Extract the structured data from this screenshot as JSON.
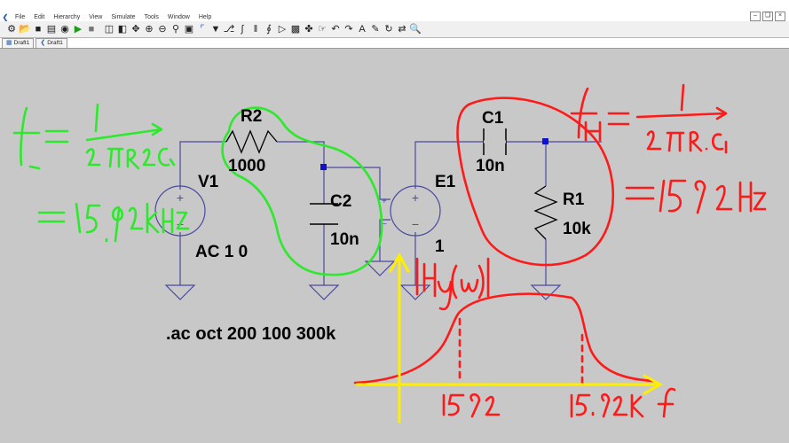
{
  "menu": [
    "File",
    "Edit",
    "Hierarchy",
    "View",
    "Simulate",
    "Tools",
    "Window",
    "Help"
  ],
  "toolbar_icons": [
    "hammer-icon",
    "open-icon",
    "save-icon",
    "print-icon",
    "cut-icon",
    "run-icon",
    "halt-icon",
    "tile-icon",
    "cascade-icon",
    "pan-icon",
    "zoom-in-icon",
    "zoom-out-icon",
    "zoom-fit-icon",
    "zoom-area-icon",
    "wire-icon",
    "ground-icon",
    "label-icon",
    "resistor-icon",
    "capacitor-icon",
    "inductor-icon",
    "diode-icon",
    "component-icon",
    "move-icon",
    "drag-icon",
    "undo-icon",
    "redo-icon",
    "text-icon",
    "spice-directive-icon",
    "rotate-icon",
    "mirror-icon",
    "find-icon"
  ],
  "tabs": [
    {
      "label": "Draft1"
    },
    {
      "label": "Draft1"
    }
  ],
  "schematic": {
    "v1_name": "V1",
    "v1_value": "AC 1 0",
    "r2_name": "R2",
    "r2_value": "1000",
    "c2_name": "C2",
    "c2_value": "10n",
    "e1_name": "E1",
    "e1_value": "1",
    "c1_name": "C1",
    "c1_value": "10n",
    "r1_name": "R1",
    "r1_value": "10k",
    "directive": ".ac oct 200 100 300k"
  },
  "annotations": {
    "colors": {
      "green": "#2ee82e",
      "red": "#ff1a1a",
      "yellow": "#ffee00",
      "wire": "#4a4aa0",
      "node": "#1010d0"
    }
  }
}
